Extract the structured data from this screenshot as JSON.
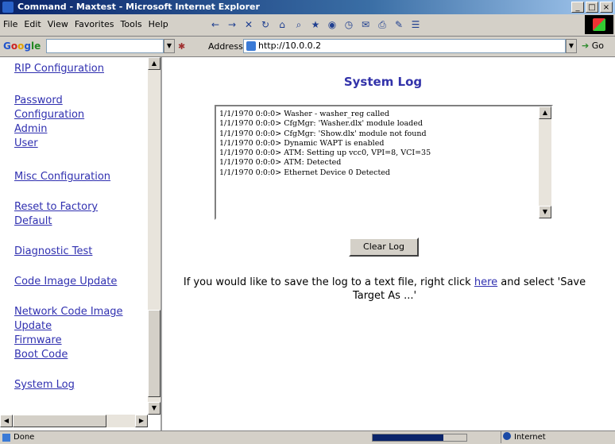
{
  "window": {
    "title": "Command - Maxtest - Microsoft Internet Explorer",
    "controls": [
      "_",
      "□",
      "×"
    ]
  },
  "menu": [
    "File",
    "Edit",
    "View",
    "Favorites",
    "Tools",
    "Help"
  ],
  "google": {
    "logo": [
      "G",
      "o",
      "o",
      "g",
      "le"
    ],
    "search_value": ""
  },
  "address": {
    "label": "Address",
    "url": "http://10.0.0.2",
    "go_label": "Go"
  },
  "nav": {
    "links": [
      [
        "RIP Configuration"
      ],
      [
        "Password",
        "Configuration"
      ],
      [
        "Admin"
      ],
      [
        "User"
      ],
      [
        "Misc Configuration"
      ],
      [
        "Reset to Factory",
        "Default"
      ],
      [
        "Diagnostic Test"
      ],
      [
        "Code Image Update"
      ],
      [
        "Network Code Image",
        "Update"
      ],
      [
        "Firmware"
      ],
      [
        "Boot Code"
      ],
      [
        "System Log"
      ]
    ]
  },
  "main": {
    "title": "System Log",
    "log_lines": [
      "1/1/1970 0:0:0> Washer - washer_reg called",
      "1/1/1970 0:0:0> CfgMgr: 'Washer.dlx' module loaded",
      "1/1/1970 0:0:0> CfgMgr: 'Show.dlx' module not found",
      "1/1/1970 0:0:0> Dynamic WAPT is enabled",
      "1/1/1970 0:0:0> ATM: Setting up vcc0, VPI=8, VCI=35",
      "1/1/1970 0:0:0> ATM: Detected",
      "1/1/1970 0:0:0> Ethernet Device 0 Detected"
    ],
    "clear_button": "Clear Log",
    "save_hint_before": "If you would like to save the log to a text file, right click ",
    "save_hint_link": "here",
    "save_hint_after": " and select 'Save Target As ...'"
  },
  "status": {
    "text": "Done",
    "zone": "Internet",
    "progress": 0.75
  }
}
